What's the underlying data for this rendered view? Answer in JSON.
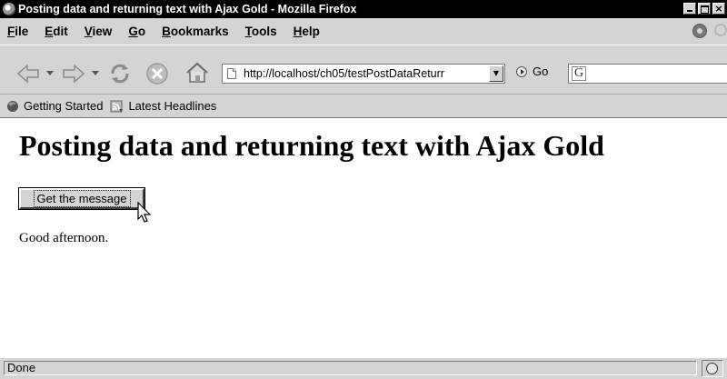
{
  "window": {
    "title": "Posting data and returning text with Ajax Gold - Mozilla Firefox",
    "close_glyph": "×"
  },
  "menubar": {
    "items": [
      {
        "underline": "F",
        "rest": "ile"
      },
      {
        "underline": "E",
        "rest": "dit"
      },
      {
        "underline": "V",
        "rest": "iew"
      },
      {
        "underline": "G",
        "rest": "o"
      },
      {
        "underline": "B",
        "rest": "ookmarks"
      },
      {
        "underline": "T",
        "rest": "ools"
      },
      {
        "underline": "H",
        "rest": "elp"
      }
    ]
  },
  "navbar": {
    "icons": [
      "back-arrow-icon",
      "forward-arrow-icon",
      "reload-icon",
      "stop-icon",
      "home-icon"
    ],
    "address_url": "http://localhost/ch05/testPostDataReturr",
    "address_dropdown_glyph": "▼",
    "go_label": "Go",
    "search_engine_glyph": "G"
  },
  "bookmarks": {
    "items": [
      {
        "label": "Getting Started",
        "icon": "firefox-icon"
      },
      {
        "label": "Latest Headlines",
        "icon": "rss-feed-icon"
      }
    ]
  },
  "content": {
    "heading": "Posting data and returning text with Ajax Gold",
    "button_label": "Get the message",
    "message": "Good afternoon."
  },
  "statusbar": {
    "text": "Done",
    "icon": "security-status-icon"
  }
}
